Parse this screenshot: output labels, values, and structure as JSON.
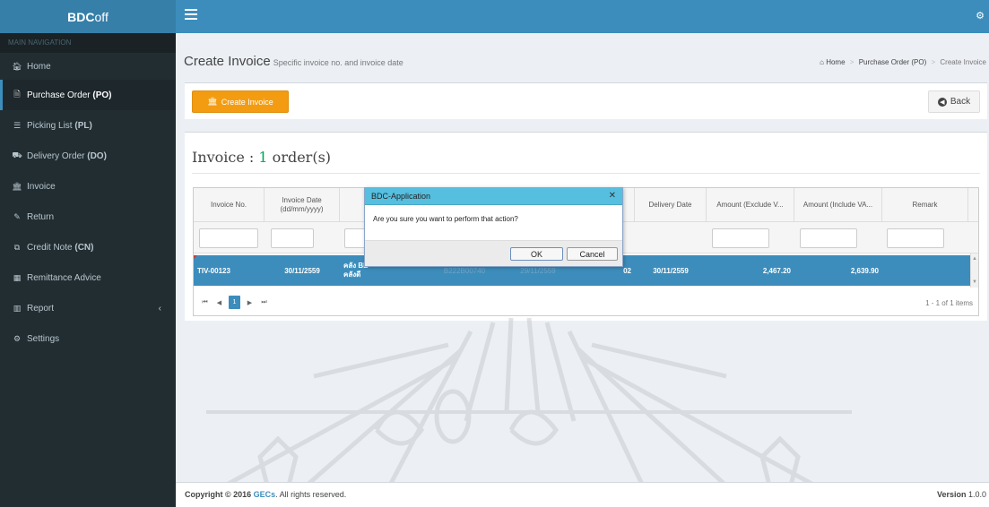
{
  "brand": {
    "bold": "BDC",
    "light": "off"
  },
  "sidebar": {
    "header": "MAIN NAVIGATION",
    "items": [
      {
        "icon": "home-icon",
        "label": "Home",
        "abbr": ""
      },
      {
        "icon": "file-icon",
        "label": "Purchase Order",
        "abbr": "(PO)"
      },
      {
        "icon": "list-icon",
        "label": "Picking List",
        "abbr": "(PL)"
      },
      {
        "icon": "truck-icon",
        "label": "Delivery Order",
        "abbr": "(DO)"
      },
      {
        "icon": "bank-icon",
        "label": "Invoice",
        "abbr": ""
      },
      {
        "icon": "edit-icon",
        "label": "Return",
        "abbr": ""
      },
      {
        "icon": "credit-note-icon",
        "label": "Credit Note",
        "abbr": "(CN)"
      },
      {
        "icon": "calendar-icon",
        "label": "Remittance Advice",
        "abbr": ""
      },
      {
        "icon": "bar-chart-icon",
        "label": "Report",
        "abbr": ""
      },
      {
        "icon": "gears-icon",
        "label": "Settings",
        "abbr": ""
      }
    ]
  },
  "header": {
    "title": "Create Invoice",
    "subtitle": "Specific invoice no. and invoice date"
  },
  "breadcrumb": {
    "home": "Home",
    "parent": "Purchase Order (PO)",
    "current": "Create Invoice"
  },
  "toolbar": {
    "create_label": "Create Invoice",
    "back_label": "Back"
  },
  "section": {
    "title_prefix": "Invoice : ",
    "count": "1",
    "title_suffix": " order(s)"
  },
  "grid": {
    "columns": [
      {
        "line1": "Invoice No.",
        "line2": ""
      },
      {
        "line1": "Invoice Date",
        "line2": "(dd/mm/yyyy)"
      },
      {
        "line1": "",
        "line2": ""
      },
      {
        "line1": "",
        "line2": ""
      },
      {
        "line1": "",
        "line2": ""
      },
      {
        "line1": "",
        "line2": ""
      },
      {
        "line1": "Delivery Date",
        "line2": ""
      },
      {
        "line1": "Amount (Exclude V...",
        "line2": ""
      },
      {
        "line1": "Amount (Include VA...",
        "line2": ""
      },
      {
        "line1": "Remark",
        "line2": ""
      }
    ],
    "row": {
      "invoice_no": "TIV-00123",
      "invoice_date": "30/11/2559",
      "warehouse_line1": "คลัง BE",
      "warehouse_line2": "คลังดี",
      "po_no": "B222B00740",
      "po_date": "29/11/2559",
      "qty": "02",
      "delivery_date": "30/11/2559",
      "amount_excl": "2,467.20",
      "amount_incl": "2,639.90",
      "remark": ""
    },
    "pager": {
      "first": "⏮",
      "prev": "◀",
      "page": "1",
      "next": "▶",
      "last": "⏭",
      "info": "1 - 1 of 1 items"
    }
  },
  "dialog": {
    "title": "BDC-Application",
    "message": "Are you sure you want to perform that action?",
    "ok": "OK",
    "cancel": "Cancel",
    "close": "✕"
  },
  "footer": {
    "copyright_prefix": "Copyright © 2016 ",
    "company": "GECs",
    "copyright_suffix": ". All rights reserved.",
    "version_label": "Version",
    "version": "1.0.0"
  },
  "colors": {
    "sidebar": "#222d32",
    "topbar": "#3c8dbc",
    "accent": "#f39c12",
    "row_selected": "#3c8dbc",
    "dialog_title": "#56bfe0"
  }
}
